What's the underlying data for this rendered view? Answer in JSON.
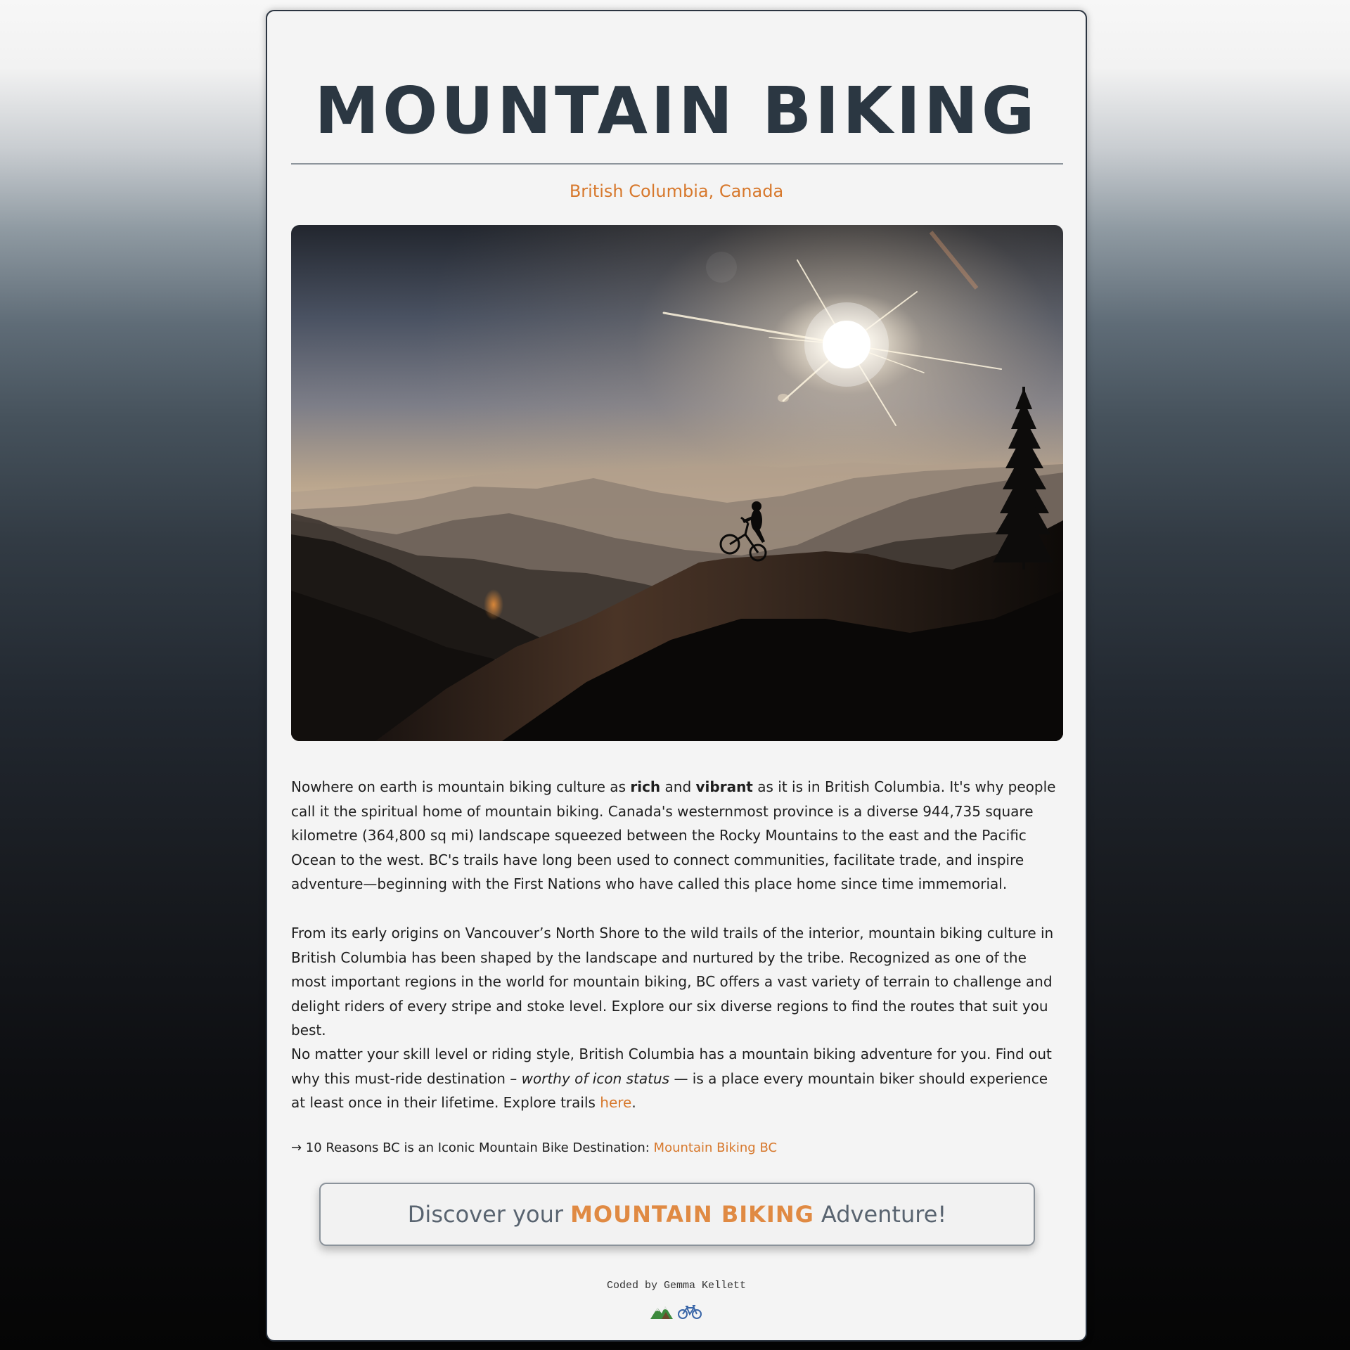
{
  "header": {
    "title": "MOUNTAIN BIKING",
    "subtitle": "British Columbia, Canada"
  },
  "hero_image": {
    "subject": "mountain biker silhouette at sunset"
  },
  "article": {
    "p1": {
      "a": "Nowhere on earth is mountain biking culture as ",
      "b1": "rich",
      "c": " and ",
      "b2": "vibrant",
      "d": " as it is in British Columbia. It's why people call it the spiritual home of mountain biking. Canada's westernmost province is a diverse 944,735 square kilometre (364,800 sq mi) landscape squeezed between the Rocky Mountains to the east and the Pacific Ocean to the west. BC's trails have long been used to connect communities, facilitate trade, and inspire adventure—beginning with the First Nations who have called this place home since time immemorial."
    },
    "p2": "From its early origins on Vancouver’s North Shore to the wild trails of the interior, mountain biking culture in British Columbia has been shaped by the landscape and nurtured by the tribe. Recognized as one of the most important regions in the world for mountain biking, BC offers a vast variety of terrain to challenge and delight riders of every stripe and stoke level. Explore our six diverse regions to find the routes that suit you best.",
    "p3": {
      "a": "No matter your skill level or riding style, British Columbia has a mountain biking adventure for you. Find out why this must-ride destination – ",
      "em": "worthy of icon status",
      "b": " — is a place every mountain biker should experience at least once in their lifetime. Explore trails ",
      "link": "here",
      "c": "."
    },
    "reasons": {
      "text": "→ 10 Reasons BC is an Iconic Mountain Bike Destination: ",
      "link": "Mountain Biking BC"
    }
  },
  "cta": {
    "pre": "Discover your",
    "highlight": "MOUNTAIN BIKING",
    "post": "Adventure!"
  },
  "footer": {
    "credit": "Coded by Gemma Kellett",
    "icons": [
      "mountain-icon",
      "bicycle-icon"
    ]
  },
  "colors": {
    "accent": "#d7782c",
    "title": "#2b3742",
    "card": "#f4f4f4"
  }
}
